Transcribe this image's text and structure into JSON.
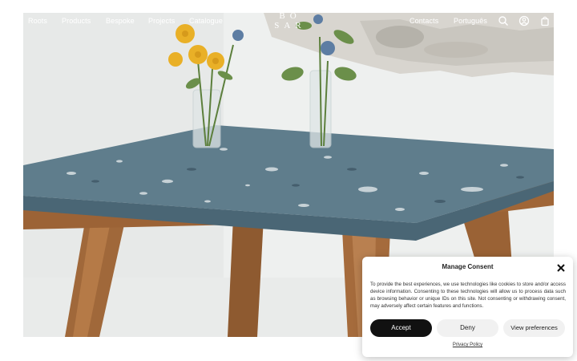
{
  "nav": {
    "items": [
      {
        "label": "Roots"
      },
      {
        "label": "Products"
      },
      {
        "label": "Bespoke"
      },
      {
        "label": "Projects"
      },
      {
        "label": "Catalogue"
      }
    ],
    "right_items": [
      {
        "label": "Contacts"
      },
      {
        "label": "Português"
      }
    ],
    "logo_line1": "BO",
    "logo_line2": "SAR",
    "icons": [
      "search-icon",
      "account-icon",
      "bag-icon"
    ]
  },
  "hero": {
    "image": "product-photo-terrazzo-table-with-flowers"
  },
  "consent": {
    "title": "Manage Consent",
    "text": "To provide the best experiences, we use technologies like cookies to store and/or access device information. Consenting to these technologies will allow us to process data such as browsing behavior or unique IDs on this site. Not consenting or withdrawing consent, may adversely affect certain features and functions.",
    "accept_label": "Accept",
    "deny_label": "Deny",
    "view_label": "View preferences",
    "privacy_label": "Privacy Policy"
  },
  "colors": {
    "accept_bg": "#111111",
    "secondary_bg": "#f1f1f1",
    "nav_text": "#ffffff"
  }
}
